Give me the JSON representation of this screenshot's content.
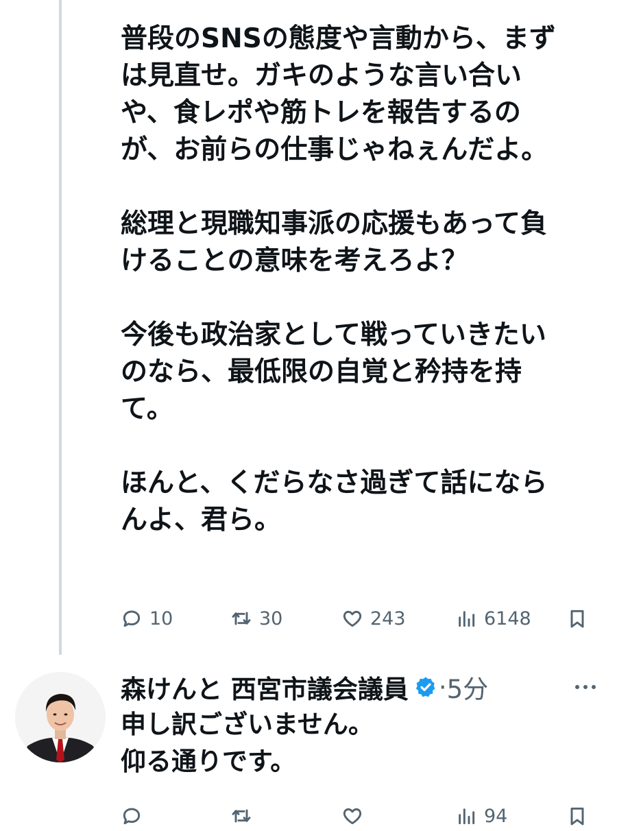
{
  "tweet": {
    "body": "普段のSNSの態度や言動から、まず\nは見直せ。ガキのような言い合い\nや、食レポや筋トレを報告するの\nが、お前らの仕事じゃねぇんだよ。\n\n総理と現職知事派の応援もあって負\nけることの意味を考えろよ？\n\n今後も政治家として戦っていきたい\nのなら、最低限の自覚と矜持を持\nて。\n\nほんと、くだらなさ過ぎて話になら\nんよ、君ら。",
    "actions": {
      "reply_count": "10",
      "retweet_count": "30",
      "like_count": "243",
      "view_count": "6148"
    }
  },
  "reply": {
    "author_name": "森けんと 西宮市議会議員",
    "separator": "·",
    "time": "5分",
    "body": "申し訳ございません。\n仰る通りです。",
    "actions": {
      "reply_count": "",
      "retweet_count": "",
      "like_count": "",
      "view_count": "94"
    }
  },
  "icons": {
    "reply": "speech-bubble-icon",
    "retweet": "retweet-arrows-icon",
    "like": "heart-icon",
    "views": "bar-chart-icon",
    "bookmark": "bookmark-icon",
    "verified": "verified-badge-icon",
    "more": "more-dots-icon"
  },
  "colors": {
    "text": "#0f1419",
    "secondary": "#536471",
    "thread_line": "#cfd9de",
    "verified": "#1d9bf0"
  }
}
